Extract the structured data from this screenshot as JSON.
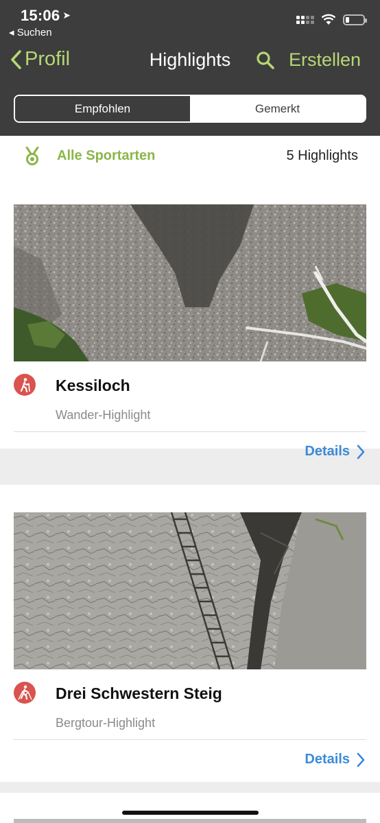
{
  "status_bar": {
    "time": "15:06",
    "back_app": "◂ Suchen"
  },
  "nav": {
    "back_label": "Profil",
    "title": "Highlights",
    "create_label": "Erstellen"
  },
  "segments": [
    {
      "label": "Empfohlen",
      "active": true
    },
    {
      "label": "Gemerkt",
      "active": false
    }
  ],
  "filter": {
    "label": "Alle Sportarten",
    "count": "5 Highlights"
  },
  "cards": [
    {
      "title": "Kessiloch",
      "subtitle": "Wander-Highlight",
      "details_label": "Details",
      "icon": "hiking-icon"
    },
    {
      "title": "Drei Schwestern Steig",
      "subtitle": "Bergtour-Highlight",
      "details_label": "Details",
      "icon": "mountaineering-icon"
    }
  ],
  "colors": {
    "header_bg": "#3d3d3d",
    "accent_green": "#8ab648",
    "link_blue": "#3b8ad9",
    "icon_red": "#d9534f"
  }
}
